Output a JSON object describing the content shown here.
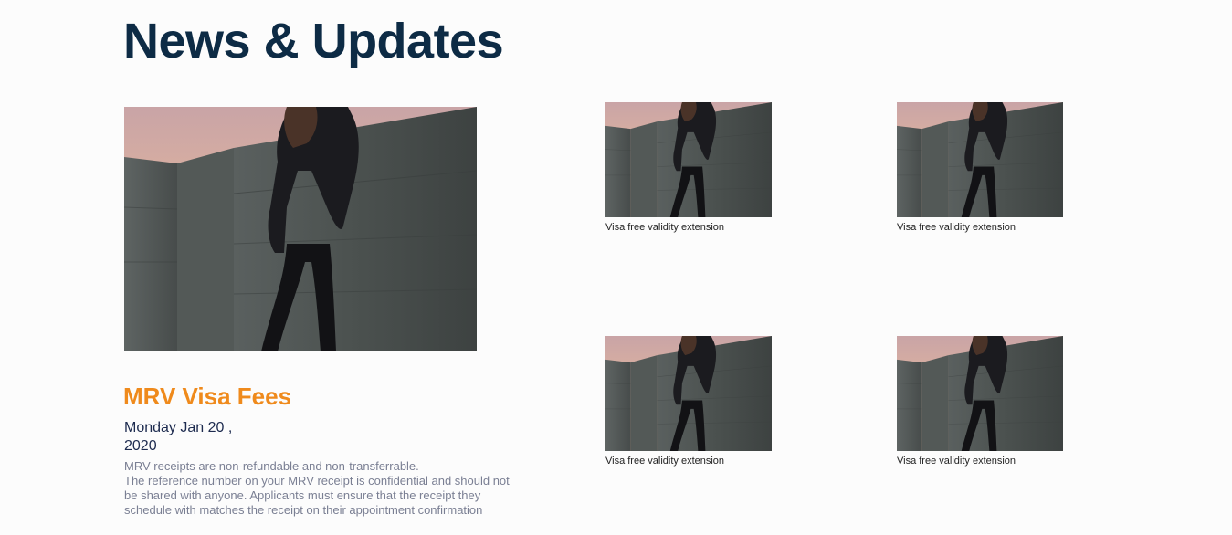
{
  "section": {
    "title": "News & Updates"
  },
  "featured": {
    "image_icon": "woman-against-wall-photo",
    "title": "MRV Visa Fees",
    "date": "Monday Jan 20 , 2020",
    "body": "MRV receipts are non-refundable and non-transferrable.\nThe reference number on your MRV receipt is confidential and should not\nbe shared with anyone. Applicants must ensure that the receipt they\nschedule with matches the receipt on their appointment confirmation"
  },
  "cards": [
    {
      "image_icon": "woman-against-wall-photo",
      "caption": "Visa free validity extension"
    },
    {
      "image_icon": "woman-against-wall-photo",
      "caption": "Visa free validity extension"
    },
    {
      "image_icon": "woman-against-wall-photo",
      "caption": "Visa free validity extension"
    },
    {
      "image_icon": "woman-against-wall-photo",
      "caption": "Visa free validity extension"
    }
  ],
  "colors": {
    "heading": "#0d2b45",
    "accent": "#ef8a1c",
    "date": "#1d2b4f",
    "body": "#7a7f93"
  }
}
